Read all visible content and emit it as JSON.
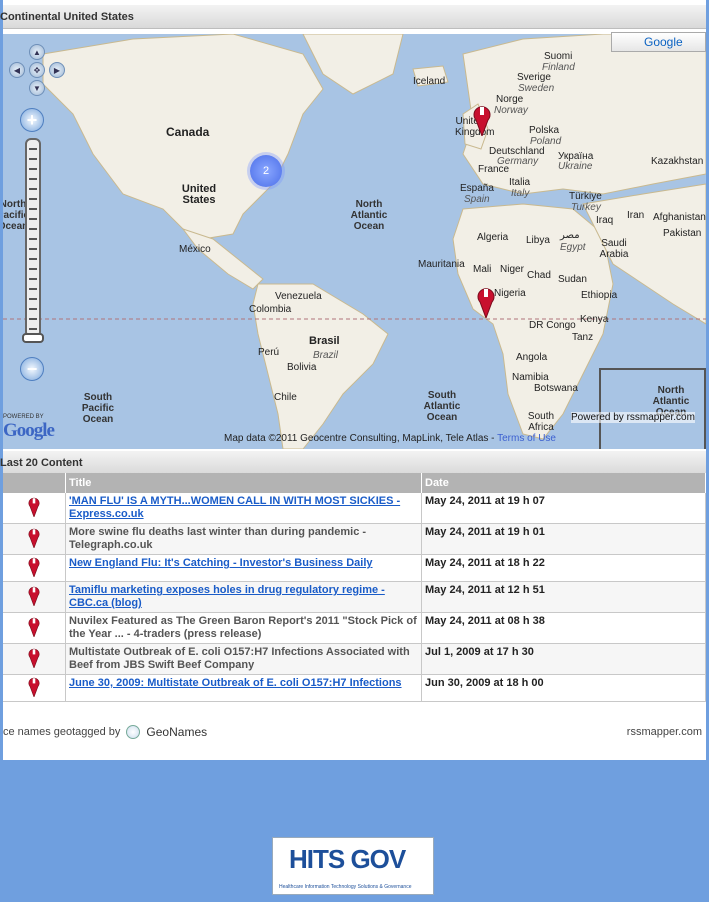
{
  "map_section": {
    "title": "Continental United States"
  },
  "map": {
    "google_button": "Google",
    "cluster_count": "2",
    "attribution": "Map data ©2011 Geocentre Consulting, MapLink, Tele Atlas - ",
    "terms_link": "Terms of Use",
    "powered_by_rss": "Powered by rssmapper.com",
    "powered_by_google_small": "POWERED BY",
    "google_logo": "Google",
    "labels": {
      "canada": "Canada",
      "united_states": "United States",
      "mexico": "México",
      "venezuela": "Venezuela",
      "colombia": "Colombia",
      "brasil": "Brasil",
      "brazil": "Brazil",
      "peru": "Perú",
      "bolivia": "Bolivia",
      "chile": "Chile",
      "north_pacific": "North Pacific Ocean",
      "south_pacific": "South Pacific Ocean",
      "north_atlantic": "North Atlantic Ocean",
      "south_atlantic": "South Atlantic Ocean",
      "north_atlantic_inset": "North Atlantic Ocean",
      "iceland": "Iceland",
      "suomi": "Suomi",
      "finland": "Finland",
      "sverige": "Sverige",
      "sweden": "Sweden",
      "norge": "Norge",
      "norway": "Norway",
      "uk": "United Kingdom",
      "polska": "Polska",
      "poland": "Poland",
      "deutschland": "Deutschland",
      "germany": "Germany",
      "ukraine_local": "Україна",
      "ukraine": "Ukraine",
      "france": "France",
      "italia": "Italia",
      "italy": "Italy",
      "espana": "España",
      "spain": "Spain",
      "turkiye": "Türkiye",
      "turkey": "Turkey",
      "kazakhstan": "Kazakhstan",
      "iraq": "Iraq",
      "iran": "Iran",
      "afghanistan": "Afghanistan",
      "pakistan": "Pakistan",
      "algeria": "Algeria",
      "libya": "Libya",
      "egypt_local": "مصر",
      "egypt": "Egypt",
      "saudi": "Saudi Arabia",
      "mauritania": "Mauritania",
      "mali": "Mali",
      "niger": "Niger",
      "chad": "Chad",
      "sudan": "Sudan",
      "nigeria": "Nigeria",
      "ethiopia": "Ethiopia",
      "dr_congo": "DR Congo",
      "kenya": "Kenya",
      "tanz": "Tanz",
      "angola": "Angola",
      "namibia": "Namibia",
      "botswana": "Botswana",
      "south_africa": "South Africa"
    }
  },
  "content_section": {
    "title": "Last 20 Content"
  },
  "table": {
    "headers": {
      "title": "Title",
      "date": "Date"
    },
    "rows": [
      {
        "title": "'MAN FLU' IS A MYTH...WOMEN CALL IN WITH MOST SICKIES - Express.co.uk",
        "date": "May 24, 2011 at 19 h 07",
        "link": true
      },
      {
        "title": "More swine flu deaths last winter than during pandemic - Telegraph.co.uk",
        "date": "May 24, 2011 at 19 h 01",
        "link": false
      },
      {
        "title": "New England Flu: It's Catching - Investor's Business Daily",
        "date": "May 24, 2011 at 18 h 22",
        "link": true
      },
      {
        "title": "Tamiflu marketing exposes holes in drug regulatory regime - CBC.ca (blog)",
        "date": "May 24, 2011 at 12 h 51",
        "link": true
      },
      {
        "title": "Nuvilex Featured as The Green Baron Report's 2011 \"Stock Pick of the Year ... - 4-traders (press release)",
        "date": "May 24, 2011 at 08 h 38",
        "link": false
      },
      {
        "title": "Multistate Outbreak of E. coli O157:H7 Infections Associated with Beef from JBS Swift Beef Company",
        "date": "Jul 1, 2009 at 17 h 30",
        "link": false
      },
      {
        "title": "June 30, 2009: Multistate Outbreak of E. coli O157:H7 Infections",
        "date": "Jun 30, 2009 at 18 h 00",
        "link": true
      }
    ]
  },
  "footer": {
    "geotag_text": "ce names geotagged by",
    "geonames": "GeoNames",
    "rssmapper": "rssmapper.com"
  },
  "logo": {
    "name": "HITS GOV",
    "tagline": "Healthcare Information Technology Solutions & Governance"
  }
}
